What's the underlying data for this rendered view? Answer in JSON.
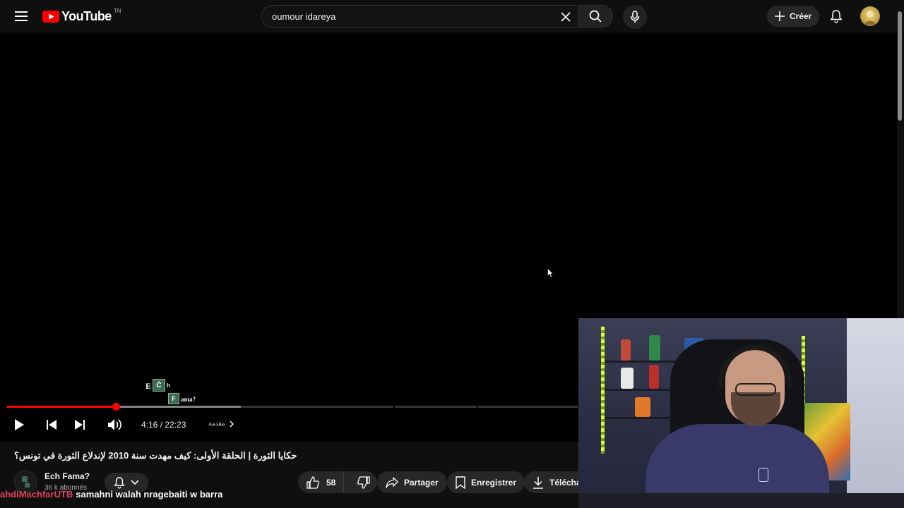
{
  "topbar": {
    "logo_text": "YouTube",
    "logo_country": "TN",
    "search_value": "oumour idareya",
    "create_label": "Créer"
  },
  "player": {
    "time_display": "4:16 / 22:23",
    "chapter_label": "مقدمة",
    "progress_played_fraction": 0.191,
    "progress_buffered_fraction": 0.41,
    "chapter_logo": {
      "e": "E",
      "c": "Ċ",
      "h": "h",
      "f": "F",
      "ama": "ama?"
    }
  },
  "video": {
    "title": "حكايا الثورة | الحلقة الأولى: كيف مهدت سنة 2010 لإندلاع الثورة في تونس؟",
    "channel_name": "Ech Fama?",
    "subscribers": "36 k abonnés"
  },
  "actions": {
    "likes": "58",
    "share_label": "Partager",
    "save_label": "Enregistrer",
    "download_label": "Téléchar"
  },
  "chat_overlay": {
    "username": "ahdiMachfarUTB",
    "message": "samahni walah nragebaiti w barra"
  },
  "colors": {
    "brand_red": "#ff0000",
    "background": "#0f0f0f",
    "chip": "#272727",
    "chat_user": "#e0415e"
  }
}
